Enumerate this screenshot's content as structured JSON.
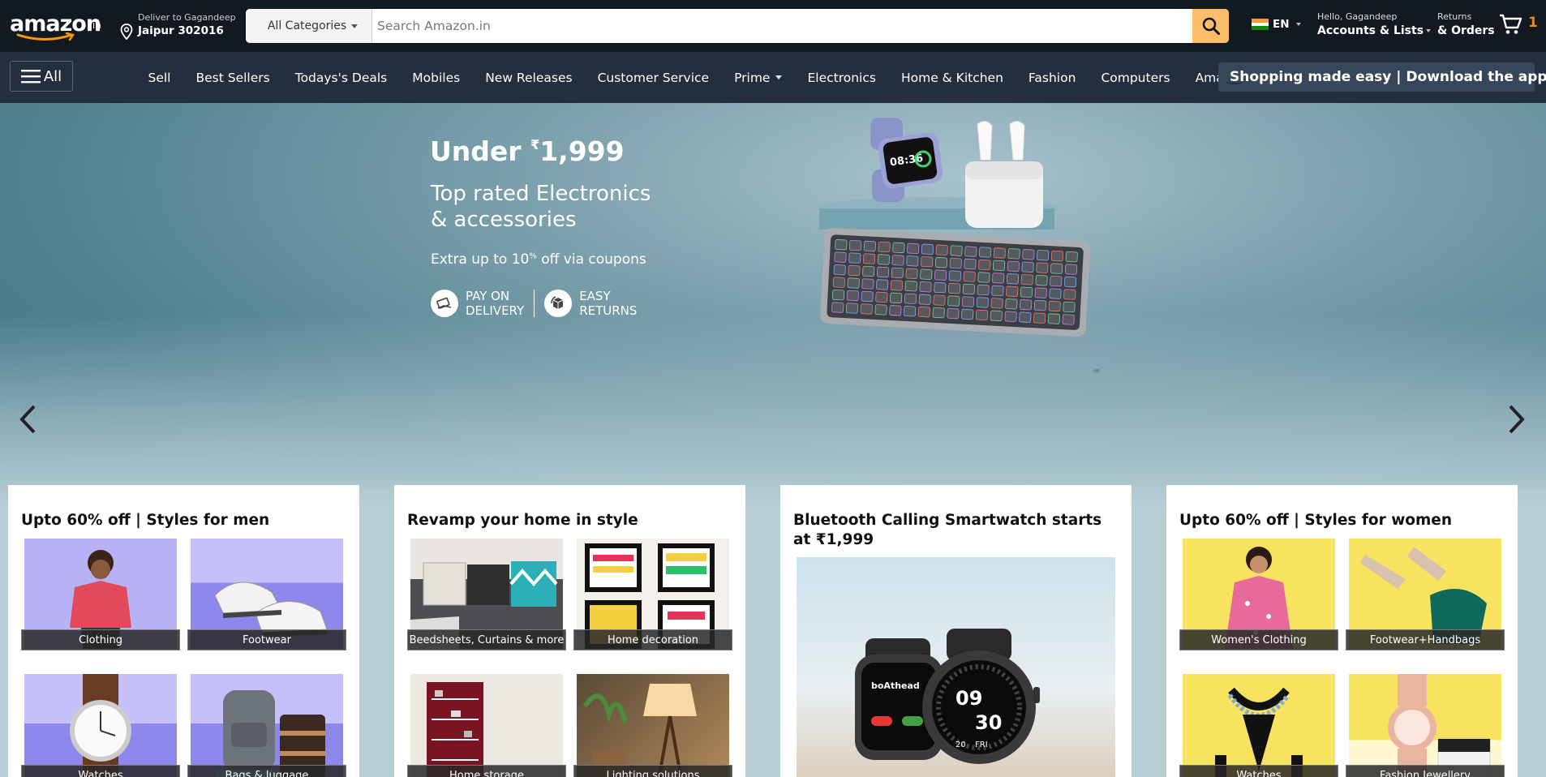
{
  "header": {
    "logo_text": "amazon",
    "logo_tld": ".in",
    "deliver_line1": "Deliver to Gagandeep",
    "deliver_line2": "Jaipur 302016",
    "search_category": "All Categories",
    "search_placeholder": "Search Amazon.in",
    "search_value": "",
    "language": "EN",
    "account_line1": "Hello, Gagandeep",
    "account_line2": "Accounts & Lists",
    "orders_line1": "Returns",
    "orders_line2": "& Orders",
    "cart_count": "1"
  },
  "nav": {
    "all_label": "All",
    "links": [
      "Sell",
      "Best Sellers",
      "Todays's Deals",
      "Mobiles",
      "New Releases",
      "Customer Service",
      "Prime",
      "Electronics",
      "Home & Kitchen",
      "Fashion",
      "Computers",
      "Amazon Pay"
    ],
    "app_banner": "Shopping made easy | Download the app"
  },
  "hero": {
    "title_prefix": "Under ",
    "title_currency": "₹",
    "title_amount": "1,999",
    "subtitle_line1": "Top rated Electronics",
    "subtitle_line2": "& accessories",
    "offer_text_before": "Extra up to 10",
    "offer_sup": "%",
    "offer_text_after": " off via coupons",
    "badge1_line1": "PAY ON",
    "badge1_line2": "DELIVERY",
    "badge2_line1": "EASY",
    "badge2_line2": "RETURNS",
    "watch_time_hh": "08:36"
  },
  "cards": [
    {
      "title": "Upto 60% off | Styles for men",
      "tiles": [
        "Clothing",
        "Footwear",
        "Watches",
        "Bags & luggage"
      ]
    },
    {
      "title": "Revamp your home in style",
      "tiles": [
        "Beedsheets, Curtains & more",
        "Home decoration",
        "Home storage",
        "Lighting solutions"
      ]
    },
    {
      "title": "Bluetooth Calling Smartwatch starts at ₹1,999",
      "watch_brand": "boAthead",
      "watch_hour": "09",
      "watch_min": "30",
      "watch_day": "FRI",
      "watch_date": "20"
    },
    {
      "title": "Upto 60% off | Styles for women",
      "tiles": [
        "Women's Clothing",
        "Footwear+Handbags",
        "Watches",
        "Fashion Jewellery"
      ]
    }
  ],
  "colors": {
    "header_bg": "#131921",
    "nav_bg": "#232f3e",
    "search_button": "#febd69",
    "cart_count": "#f08804"
  }
}
